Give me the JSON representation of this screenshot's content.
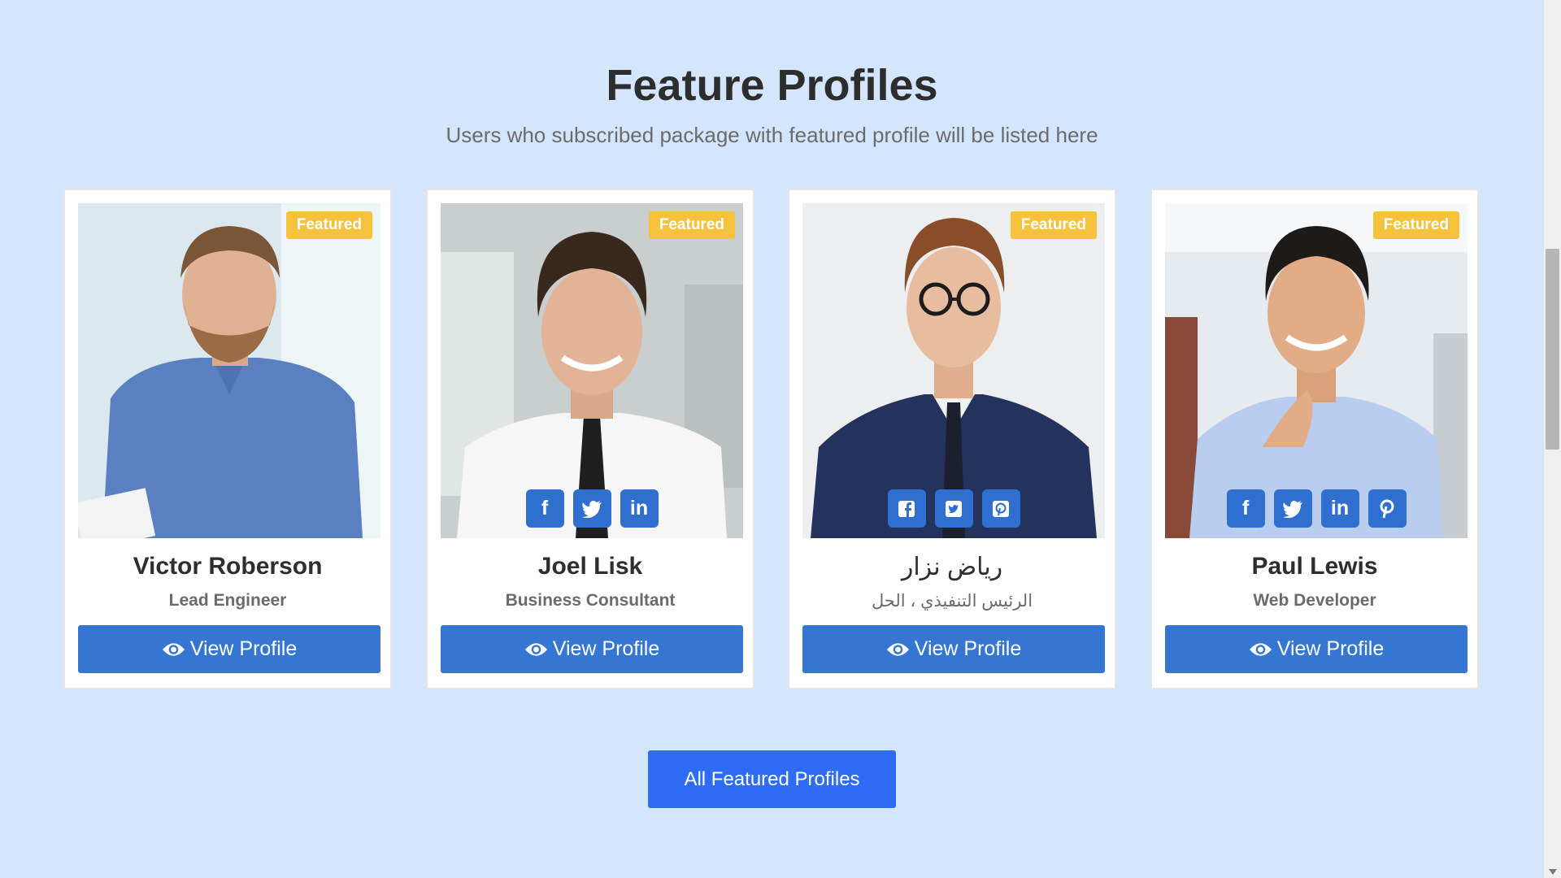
{
  "section": {
    "title": "Feature Profiles",
    "subtitle": "Users who subscribed package with featured profile will be listed here"
  },
  "badge_color": "#f7c23b",
  "button_color": "#3476d1",
  "profiles": [
    {
      "name": "Victor Roberson",
      "role": "Lead Engineer",
      "badge": "Featured",
      "view_label": "View Profile",
      "socials": []
    },
    {
      "name": "Joel Lisk",
      "role": "Business Consultant",
      "badge": "Featured",
      "view_label": "View Profile",
      "socials": [
        "facebook-icon",
        "twitter-icon",
        "linkedin-icon"
      ]
    },
    {
      "name": "رياض نزار",
      "role": "الرئيس التنفيذي ، الحل",
      "badge": "Featured",
      "view_label": "View Profile",
      "socials": [
        "facebook-square-icon",
        "twitter-square-icon",
        "pinterest-square-icon"
      ]
    },
    {
      "name": "Paul Lewis",
      "role": "Web Developer",
      "badge": "Featured",
      "view_label": "View Profile",
      "socials": [
        "facebook-icon",
        "twitter-icon",
        "linkedin-icon",
        "pinterest-icon"
      ]
    }
  ],
  "all_button": "All Featured Profiles"
}
